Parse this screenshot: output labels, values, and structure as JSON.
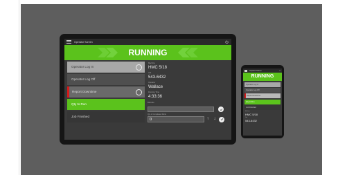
{
  "app": {
    "title": "Operator Screen",
    "state": "RUNNING",
    "colors": {
      "running": "#5bc21c",
      "alert": "#d51b1b",
      "bezel": "#151515",
      "backdrop": "#5e5e5e"
    }
  },
  "icons": {
    "menu": "hamburger-icon",
    "power": "power-icon",
    "close": "close-icon",
    "chevron": "chevron-icon",
    "check": "check-icon"
  },
  "tablet": {
    "actions": [
      {
        "label": "Operator Log In"
      },
      {
        "label": "Operator Log Off"
      },
      {
        "label": "Report Downtime"
      },
      {
        "label": "Qty to Run"
      },
      {
        "label": "Job Finished"
      }
    ],
    "info": [
      {
        "label": "Machine",
        "value": "HMC 5/18"
      },
      {
        "label": "Job",
        "value": "543-6432"
      },
      {
        "label": "Operator",
        "value": "Wallace"
      },
      {
        "label": "Running Time",
        "value": "4:33:36"
      }
    ],
    "barcode_label": "Barcode",
    "barcode_value": "",
    "qty_label": "Qty of Completed Parts",
    "qty_value": "0",
    "up_arrow": "↑",
    "down_arrow": "↓"
  },
  "phone": {
    "close_glyph": "×",
    "actions": [
      {
        "label": "Operator Log In"
      },
      {
        "label": "Operator Log Off"
      },
      {
        "label": "Report Downtime"
      },
      {
        "label": "Qty to Run"
      },
      {
        "label": "Job Finished"
      }
    ],
    "info": [
      {
        "label": "Machine",
        "value": "HMC 5/18"
      },
      {
        "label": "Job",
        "value": "543-6432"
      }
    ]
  }
}
